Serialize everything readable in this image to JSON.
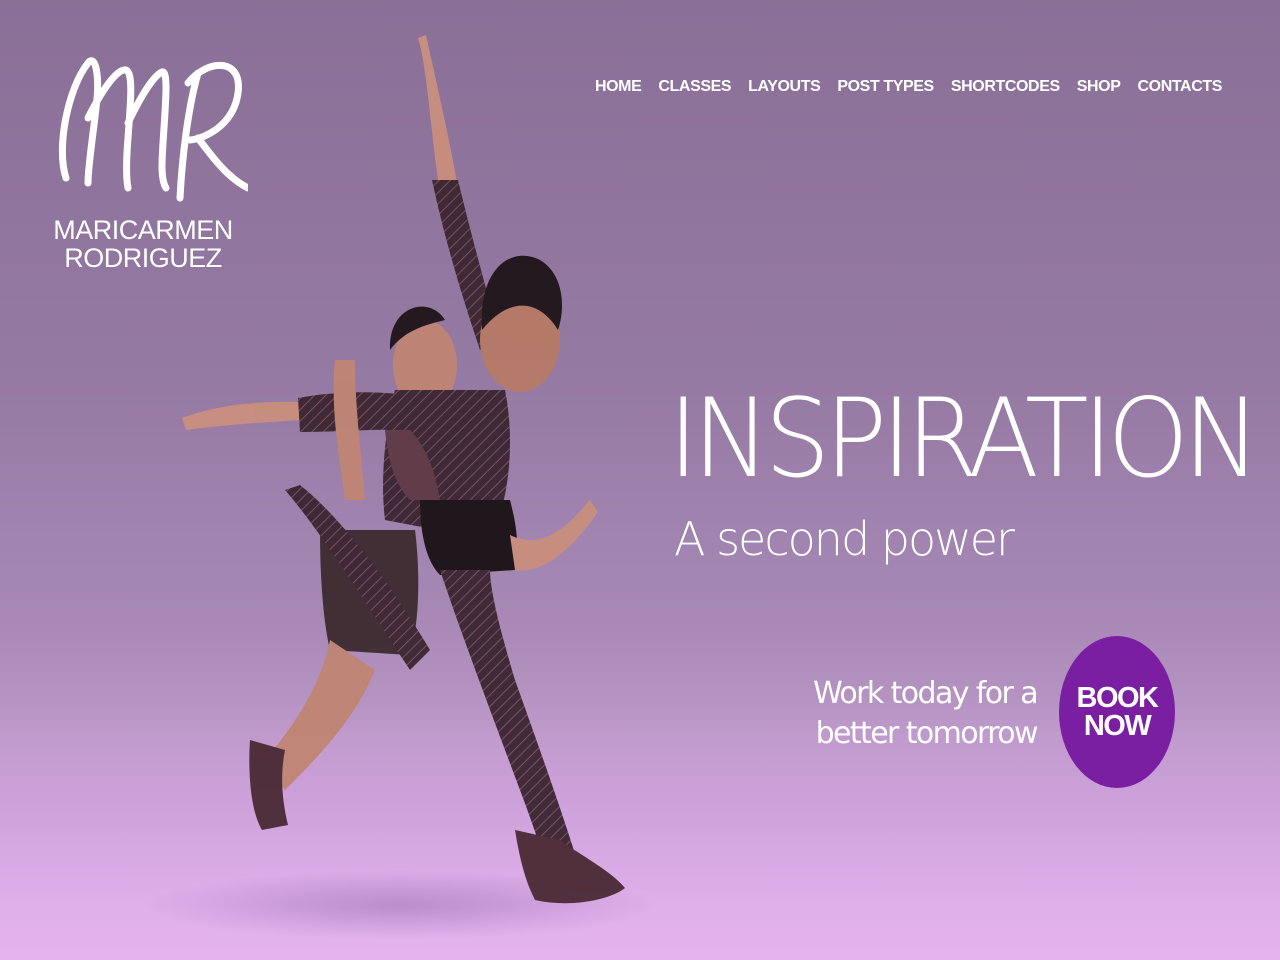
{
  "logo": {
    "monogram": "MR",
    "name_line1": "MARICARMEN",
    "name_line2": "RODRIGUEZ"
  },
  "nav": {
    "items": [
      {
        "label": "HOME"
      },
      {
        "label": "CLASSES"
      },
      {
        "label": "LAYOUTS"
      },
      {
        "label": "POST TYPES"
      },
      {
        "label": "SHORTCODES"
      },
      {
        "label": "SHOP"
      },
      {
        "label": "CONTACTS"
      }
    ]
  },
  "hero": {
    "title": "INSPIRATION",
    "subtitle": "A second power",
    "tagline_line1": "Work today for a",
    "tagline_line2": "better tomorrow",
    "cta_line1": "BOOK",
    "cta_line2": "NOW"
  },
  "colors": {
    "background_top": "#8a6f97",
    "background_bottom": "#e0b6ea",
    "cta_background": "#7b1fa2",
    "text": "#ffffff"
  }
}
